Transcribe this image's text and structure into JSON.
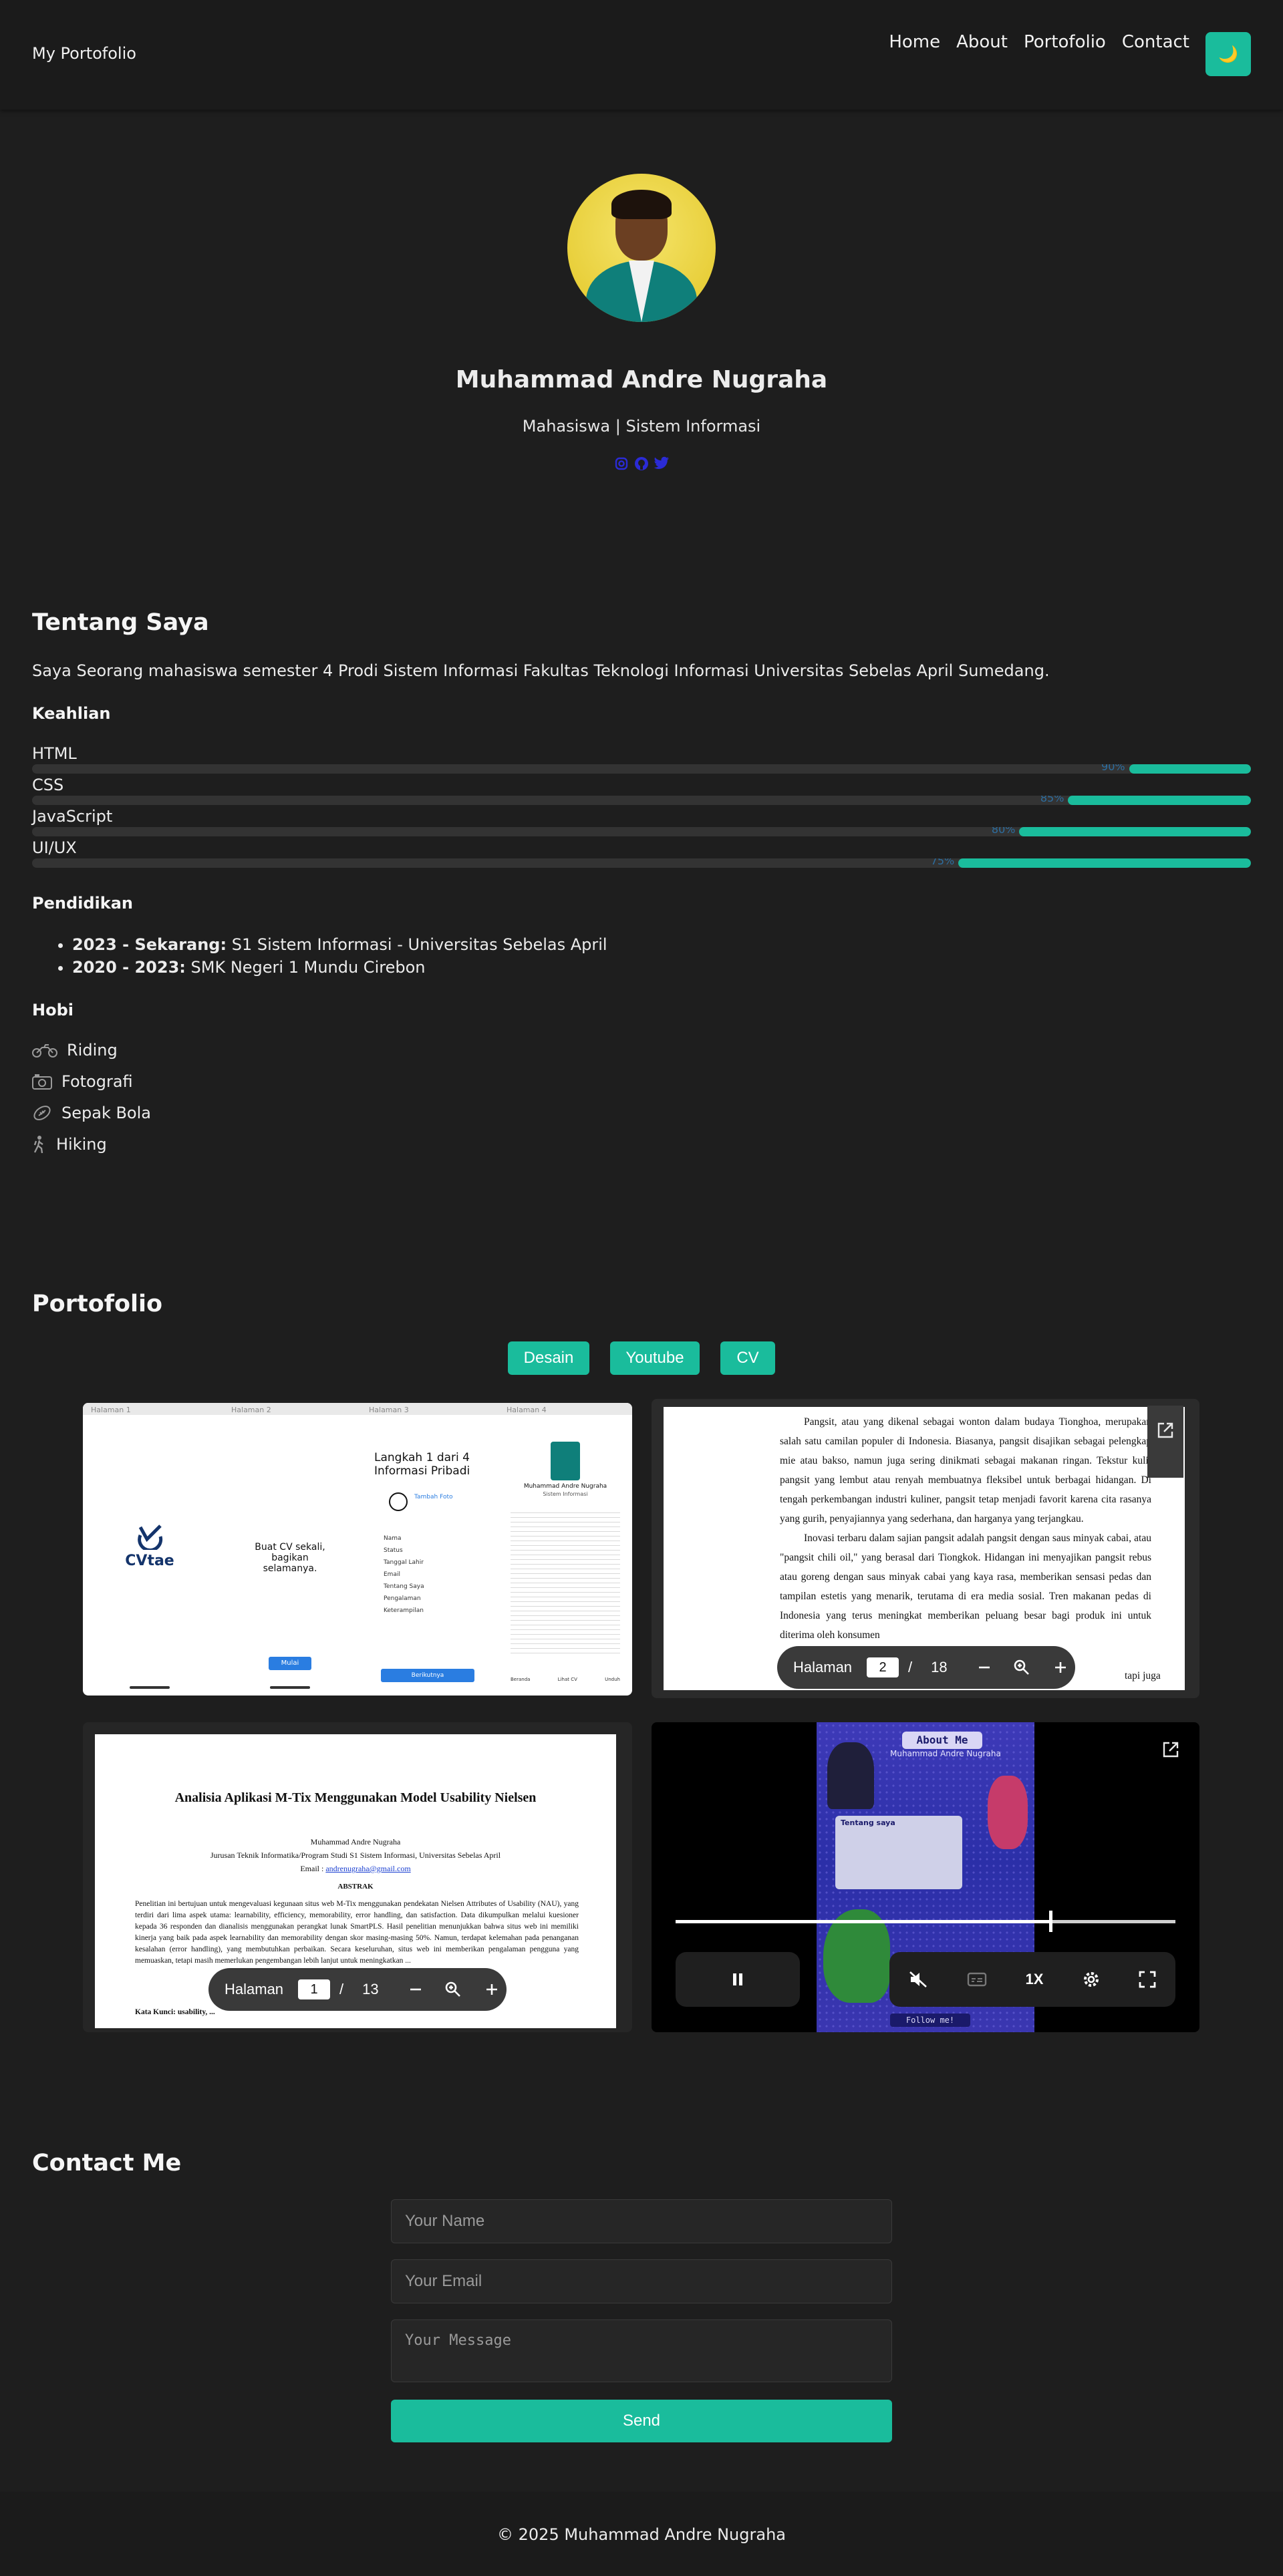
{
  "nav": {
    "brand": "My Portofolio",
    "links": [
      "Home",
      "About",
      "Portofolio",
      "Contact"
    ],
    "theme_icon": "moon-icon",
    "theme_glyph": "🌙"
  },
  "profile": {
    "name": "Muhammad Andre Nugraha",
    "role": "Mahasiswa | Sistem Informasi",
    "social_icons": [
      "instagram-icon",
      "github-icon",
      "twitter-icon"
    ]
  },
  "about": {
    "title": "Tentang Saya",
    "text": "Saya Seorang mahasiswa semester 4 Prodi Sistem Informasi Fakultas Teknologi Informasi Universitas Sebelas April Sumedang.",
    "skills_title": "Keahlian",
    "skills": [
      {
        "name": "HTML",
        "percent_label": "90%",
        "level": 0.1
      },
      {
        "name": "CSS",
        "percent_label": "85%",
        "level": 0.15
      },
      {
        "name": "JavaScript",
        "percent_label": "80%",
        "level": 0.19
      },
      {
        "name": "UI/UX",
        "percent_label": "75%",
        "level": 0.24
      }
    ],
    "education_title": "Pendidikan",
    "education": [
      {
        "years": "2023 - Sekarang:",
        "detail": "S1 Sistem Informasi - Universitas Sebelas April"
      },
      {
        "years": "2020 - 2023:",
        "detail": "SMK Negeri 1 Mundu Cirebon"
      }
    ],
    "hobbies_title": "Hobi",
    "hobbies": [
      {
        "label": "Riding",
        "icon": "motorcycle-icon"
      },
      {
        "label": "Fotografi",
        "icon": "camera-icon"
      },
      {
        "label": "Sepak Bola",
        "icon": "football-icon"
      },
      {
        "label": "Hiking",
        "icon": "hiking-icon"
      }
    ]
  },
  "portfolio": {
    "title": "Portofolio",
    "filters": [
      "Desain",
      "Youtube",
      "CV"
    ],
    "design_card": {
      "page_labels": [
        "Halaman 1",
        "Halaman 2",
        "Halaman 3",
        "Halaman 4"
      ],
      "logo": "CVtae",
      "tagline": "Buat CV sekali, bagikan selamanya.",
      "step_title": "Langkah 1 dari 4 Informasi Pribadi",
      "add_photo": "Tambah Foto",
      "fields": [
        "Nama",
        "Status",
        "Tanggal Lahir",
        "Email",
        "Tentang Saya",
        "Pengalaman",
        "Keterampilan"
      ],
      "next_btn": "Berikutnya",
      "start_btn": "Mulai",
      "cv_name": "Muhammad Andre Nugraha",
      "cv_role": "Sistem Informasi",
      "tabs": [
        "Beranda",
        "Lihat CV",
        "Unduh"
      ]
    },
    "pdf_card_1": {
      "paragraphs": [
        "Pangsit, atau yang dikenal sebagai wonton dalam budaya Tionghoa, merupakan salah satu camilan populer di Indonesia. Biasanya, pangsit disajikan sebagai pelengkap mie atau bakso, namun juga sering dinikmati sebagai makanan ringan. Tekstur kulit pangsit yang lembut atau renyah membuatnya fleksibel untuk berbagai hidangan. Di tengah perkembangan industri kuliner, pangsit tetap menjadi favorit karena cita rasanya yang gurih, penyajiannya yang sederhana, dan harganya yang terjangkau.",
        "Inovasi terbaru dalam sajian pangsit adalah pangsit dengan saus minyak cabai, atau \"pangsit chili oil,\" yang berasal dari Tiongkok. Hidangan ini menyajikan pangsit rebus atau goreng dengan saus minyak cabai yang kaya rasa, memberikan sensasi pedas dan tampilan estetis yang menarik, terutama di era media sosial. Tren makanan pedas di Indonesia yang terus meningkat memberikan peluang besar bagi produk ini untuk diterima oleh konsumen"
      ],
      "page_label": "Halaman",
      "page_current": "2",
      "page_sep": "/",
      "page_total": "18",
      "tail_text": "tapi juga"
    },
    "pdf_card_2": {
      "title": "Analisia Aplikasi M-Tix Menggunakan Model Usability Nielsen",
      "author": "Muhammad Andre Nugraha",
      "affiliation": "Jurusan Teknik Informatika/Program Studi S1 Sistem Informasi, Universitas Sebelas April",
      "email_label": "Email :",
      "email": "andrenugraha@gmail.com",
      "abstract_title": "ABSTRAK",
      "abstract": "Penelitian ini bertujuan untuk mengevaluasi kegunaan situs web M-Tix menggunakan pendekatan Nielsen Attributes of Usability (NAU), yang terdiri dari lima aspek utama: learnability, efficiency, memorability, error handling, dan satisfaction. Data dikumpulkan melalui kuesioner kepada 36 responden dan dianalisis menggunakan perangkat lunak SmartPLS. Hasil penelitian menunjukkan bahwa situs web ini memiliki kinerja yang baik pada aspek learnability dan memorability dengan skor masing-masing 50%. Namun, terdapat kelemahan pada penanganan kesalahan (error handling), yang membutuhkan perbaikan. Secara keseluruhan, situs web ini memberikan pengalaman pengguna yang memuaskan, tetapi masih memerlukan pengembangan lebih lanjut untuk meningkatkan ...",
      "keywords": "Kata Kunci: usability, ...",
      "page_label": "Halaman",
      "page_current": "1",
      "page_sep": "/",
      "page_total": "13"
    },
    "video_card": {
      "heading": "About Me",
      "caption": "Muhammad Andre Nugraha",
      "section": "Tentang saya",
      "follow": "Follow me!",
      "speed": "1X",
      "progress": 0.75
    }
  },
  "contact": {
    "title": "Contact Me",
    "name_placeholder": "Your Name",
    "email_placeholder": "Your Email",
    "message_placeholder": "Your Message",
    "send": "Send"
  },
  "footer": {
    "text": "© 2025 Muhammad Andre Nugraha"
  },
  "colors": {
    "accent": "#1abc9c",
    "background": "#1e1e1e",
    "navbar": "#1b1b1b",
    "skill_label": "#2d6ea0"
  }
}
